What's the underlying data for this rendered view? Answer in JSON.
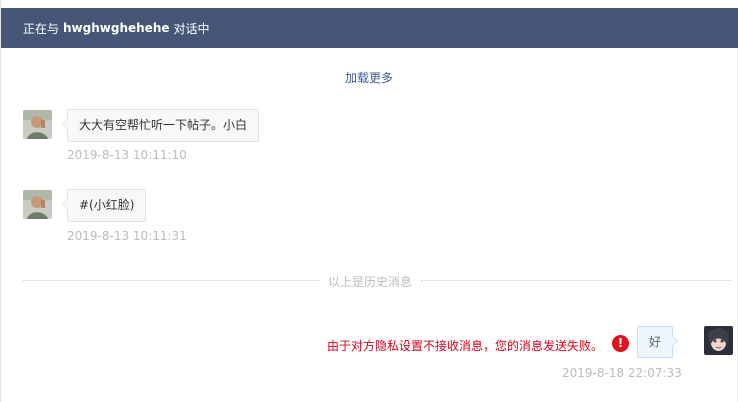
{
  "header": {
    "prefix": "正在与",
    "username": "hwghwghehehe",
    "suffix": "对话中"
  },
  "load_more": "加载更多",
  "messages": [
    {
      "text": "大大有空帮忙听一下帖子。小白",
      "time": "2019-8-13 10:11:10",
      "side": "left"
    },
    {
      "text": "#(小红脸)",
      "time": "2019-8-13 10:11:31",
      "side": "left"
    }
  ],
  "history_divider": "以上是历史消息",
  "sent": {
    "text": "好",
    "time": "2019-8-18 22:07:33",
    "error": "由于对方隐私设置不接收消息，您的消息发送失败。",
    "error_icon": "!"
  },
  "colors": {
    "header_bg": "#475677",
    "link": "#3a5c9b",
    "error": "#d9001b"
  }
}
